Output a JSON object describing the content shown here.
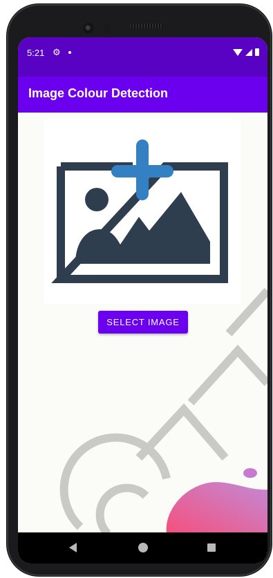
{
  "status_bar": {
    "time": "5:21",
    "icons": [
      "gear-icon",
      "notification-dot-icon",
      "wifi-icon",
      "signal-icon",
      "battery-icon"
    ]
  },
  "app_bar": {
    "title": "Image Colour Detection"
  },
  "main": {
    "image_placeholder_icon": "add-image-icon",
    "select_button_label": "SELECT IMAGE"
  },
  "nav_bar": {
    "icons": [
      "back-icon",
      "home-icon",
      "recents-icon"
    ]
  },
  "colors": {
    "status_bar": "#5a02c4",
    "app_bar": "#6a00ee",
    "button": "#6a00ee",
    "icon_dark": "#2e3e4e",
    "icon_plus": "#3381c3",
    "background": "#fbfbf8"
  }
}
